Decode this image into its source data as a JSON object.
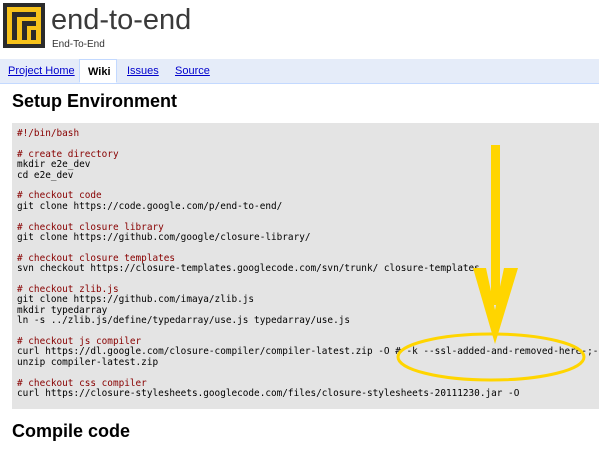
{
  "header": {
    "project_name": "end-to-end",
    "project_summary": "End-To-End",
    "logo_icon": "project-logo-icon"
  },
  "tabs": [
    {
      "label": "Project Home",
      "active": false
    },
    {
      "label": "Wiki",
      "active": true
    },
    {
      "label": "Issues",
      "active": false
    },
    {
      "label": "Source",
      "active": false
    }
  ],
  "content": {
    "heading_setup": "Setup Environment",
    "heading_compile": "Compile code",
    "code_lines": [
      {
        "kind": "comment",
        "text": "#!/bin/bash"
      },
      {
        "kind": "blank",
        "text": ""
      },
      {
        "kind": "comment",
        "text": "# create directory"
      },
      {
        "kind": "code",
        "text": "mkdir e2e_dev"
      },
      {
        "kind": "code",
        "text": "cd e2e_dev"
      },
      {
        "kind": "blank",
        "text": ""
      },
      {
        "kind": "comment",
        "text": "# checkout code"
      },
      {
        "kind": "code",
        "text": "git clone https://code.google.com/p/end-to-end/"
      },
      {
        "kind": "blank",
        "text": ""
      },
      {
        "kind": "comment",
        "text": "# checkout closure library"
      },
      {
        "kind": "code",
        "text": "git clone https://github.com/google/closure-library/"
      },
      {
        "kind": "blank",
        "text": ""
      },
      {
        "kind": "comment",
        "text": "# checkout closure templates"
      },
      {
        "kind": "code",
        "text": "svn checkout https://closure-templates.googlecode.com/svn/trunk/ closure-templates"
      },
      {
        "kind": "blank",
        "text": ""
      },
      {
        "kind": "comment",
        "text": "# checkout zlib.js"
      },
      {
        "kind": "code",
        "text": "git clone https://github.com/imaya/zlib.js"
      },
      {
        "kind": "code",
        "text": "mkdir typedarray"
      },
      {
        "kind": "code",
        "text": "ln -s ../zlib.js/define/typedarray/use.js typedarray/use.js"
      },
      {
        "kind": "blank",
        "text": ""
      },
      {
        "kind": "comment",
        "text": "# checkout js compiler"
      },
      {
        "kind": "code",
        "text": "curl https://dl.google.com/closure-compiler/compiler-latest.zip -O # -k --ssl-added-and-removed-here-;-)"
      },
      {
        "kind": "code",
        "text": "unzip compiler-latest.zip"
      },
      {
        "kind": "blank",
        "text": ""
      },
      {
        "kind": "comment",
        "text": "# checkout css compiler"
      },
      {
        "kind": "code",
        "text": "curl https://closure-stylesheets.googlecode.com/files/closure-stylesheets-20111230.jar -O"
      }
    ]
  },
  "annotation": {
    "color": "#ffd500",
    "arrow_icon": "down-arrow-icon",
    "highlight": "ellipse-highlight"
  },
  "colors": {
    "tabbar_bg": "#e5ecf9",
    "code_bg": "#e4e4e4",
    "link": "#0000cc",
    "comment": "#880000",
    "logo_yellow": "#f7c21a"
  }
}
